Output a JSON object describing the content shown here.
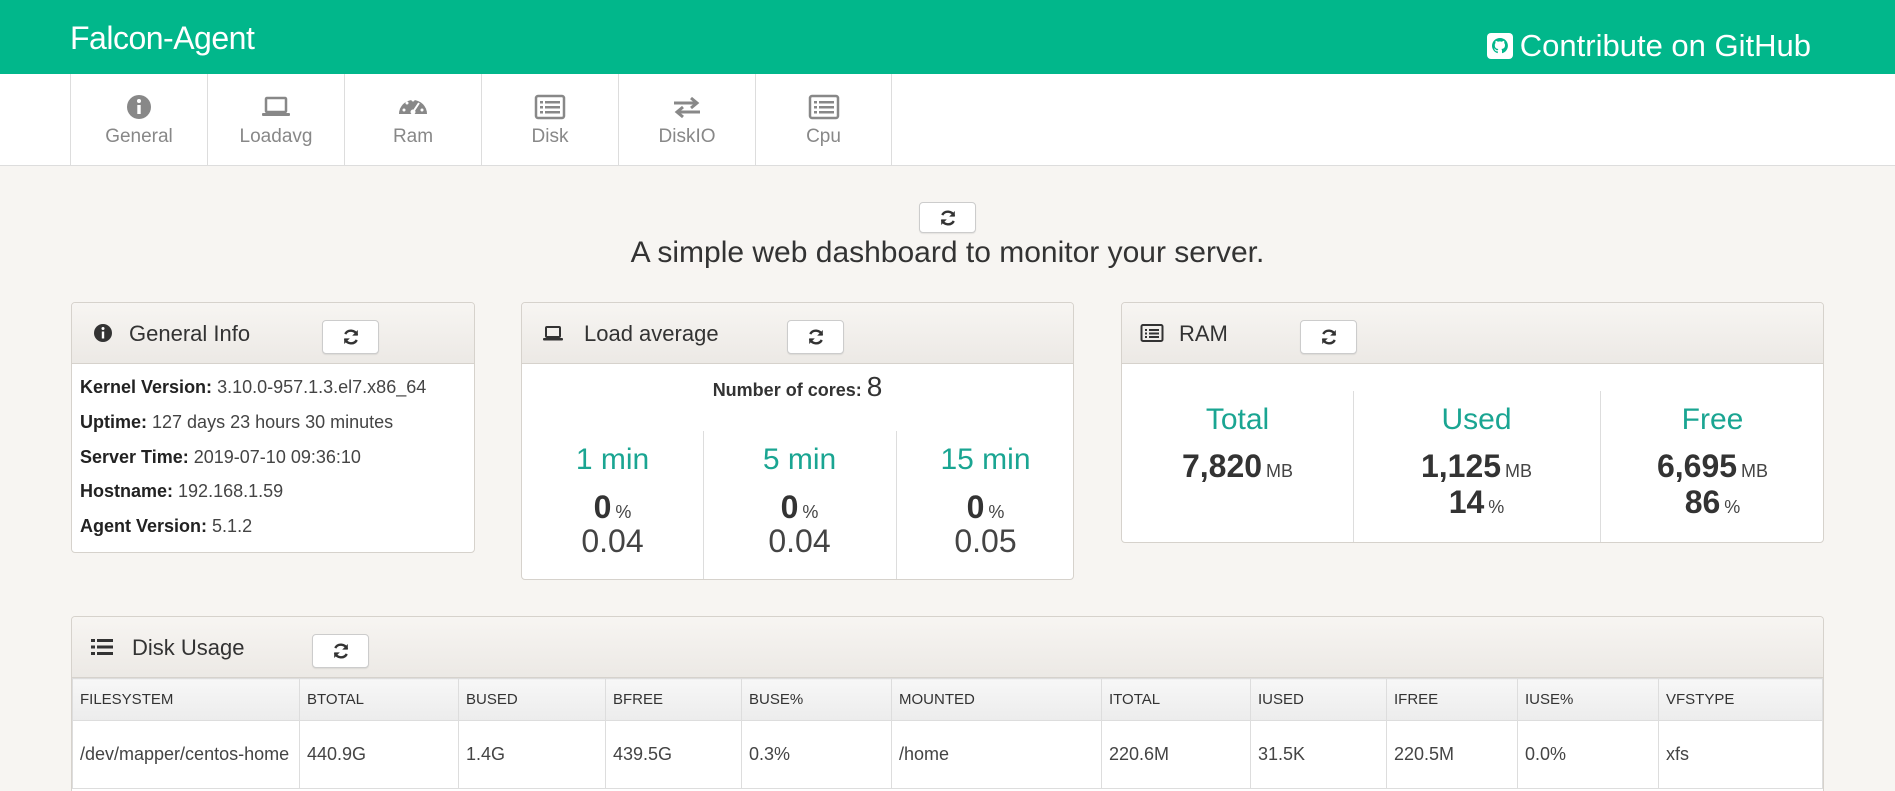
{
  "header": {
    "brand": "Falcon-Agent",
    "github_label": "Contribute on GitHub"
  },
  "tabs": [
    {
      "label": "General",
      "icon": "info-icon"
    },
    {
      "label": "Loadavg",
      "icon": "laptop-icon"
    },
    {
      "label": "Ram",
      "icon": "dashboard-icon"
    },
    {
      "label": "Disk",
      "icon": "list-alt-icon"
    },
    {
      "label": "DiskIO",
      "icon": "exchange-icon"
    },
    {
      "label": "Cpu",
      "icon": "list-alt-icon"
    }
  ],
  "tagline": "A simple web dashboard to monitor your server.",
  "general": {
    "title": "General Info",
    "rows": [
      {
        "label": "Kernel Version:",
        "value": "3.10.0-957.1.3.el7.x86_64"
      },
      {
        "label": "Uptime:",
        "value": "127 days 23 hours 30 minutes"
      },
      {
        "label": "Server Time:",
        "value": "2019-07-10 09:36:10"
      },
      {
        "label": "Hostname:",
        "value": "192.168.1.59"
      },
      {
        "label": "Agent Version:",
        "value": "5.1.2"
      }
    ]
  },
  "loadavg": {
    "title": "Load average",
    "cores_label": "Number of cores:",
    "cores_value": "8",
    "columns": [
      {
        "label": "1 min",
        "percent": "0",
        "percent_unit": "%",
        "value": "0.04"
      },
      {
        "label": "5 min",
        "percent": "0",
        "percent_unit": "%",
        "value": "0.04"
      },
      {
        "label": "15 min",
        "percent": "0",
        "percent_unit": "%",
        "value": "0.05"
      }
    ]
  },
  "ram": {
    "title": "RAM",
    "total": {
      "label": "Total",
      "value": "7,820",
      "unit": "MB"
    },
    "used": {
      "label": "Used",
      "value": "1,125",
      "unit": "MB",
      "percent": "14",
      "percent_unit": "%"
    },
    "free": {
      "label": "Free",
      "value": "6,695",
      "unit": "MB",
      "percent": "86",
      "percent_unit": "%"
    }
  },
  "disk": {
    "title": "Disk Usage",
    "columns": [
      "FILESYSTEM",
      "BTOTAL",
      "BUSED",
      "BFREE",
      "BUSE%",
      "MOUNTED",
      "ITOTAL",
      "IUSED",
      "IFREE",
      "IUSE%",
      "VFSTYPE"
    ],
    "rows": [
      [
        "/dev/mapper/centos-home",
        "440.9G",
        "1.4G",
        "439.5G",
        "0.3%",
        "/home",
        "220.6M",
        "31.5K",
        "220.5M",
        "0.0%",
        "xfs"
      ]
    ]
  },
  "colors": {
    "brand": "#01b78b",
    "accent_text": "#1aa592",
    "background": "#f7f5f2"
  }
}
